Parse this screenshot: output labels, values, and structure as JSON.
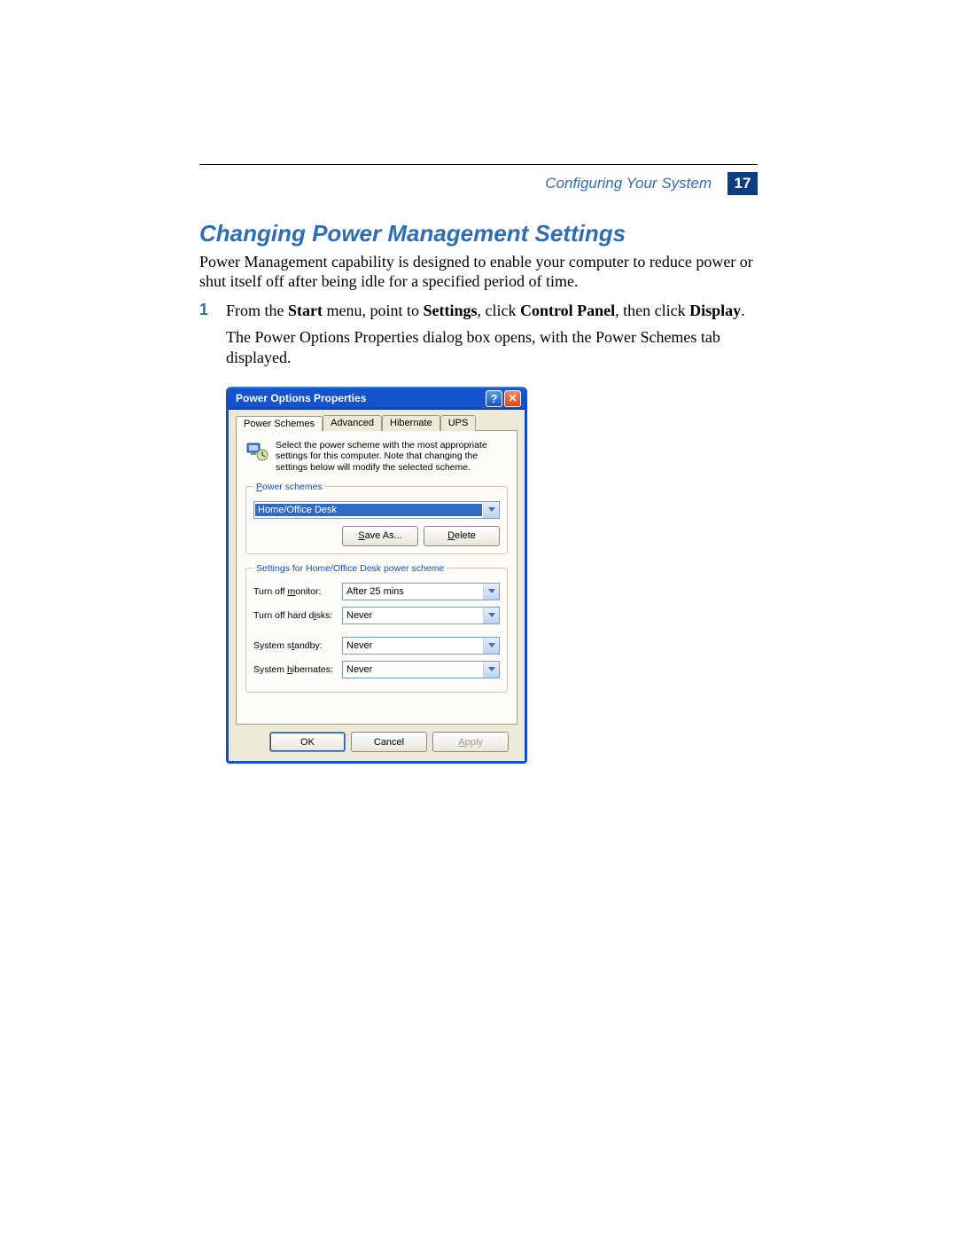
{
  "header": {
    "section": "Configuring Your System",
    "page_number": "17"
  },
  "heading": "Changing Power Management Settings",
  "intro": "Power Management capability is designed to enable your computer to reduce power or shut itself off after being idle for a specified period of time.",
  "step1": {
    "num": "1",
    "prefix": "From the ",
    "b1": "Start",
    "mid1": " menu, point to ",
    "b2": "Settings",
    "mid2": ", click ",
    "b3": "Control Panel",
    "mid3": ", then click ",
    "b4": "Display",
    "suffix": "."
  },
  "step1_follow": "The Power Options Properties dialog box opens, with the Power Schemes tab displayed.",
  "dialog": {
    "title": "Power Options Properties",
    "tabs": [
      "Power Schemes",
      "Advanced",
      "Hibernate",
      "UPS"
    ],
    "description": "Select the power scheme with the most appropriate settings for this computer. Note that changing the settings below will modify the selected scheme.",
    "group_schemes_legend": "Power schemes",
    "scheme_selected": "Home/Office Desk",
    "save_as": "Save As...",
    "delete": "Delete",
    "group_settings_legend": "Settings for Home/Office Desk power scheme",
    "settings": {
      "monitor_label_pre": "Turn off ",
      "monitor_label_ul": "m",
      "monitor_label_post": "onitor:",
      "monitor_value": "After 25 mins",
      "disks_label_pre": "Turn off hard d",
      "disks_label_ul": "i",
      "disks_label_post": "sks:",
      "disks_value": "Never",
      "standby_label_pre": "System s",
      "standby_label_ul": "t",
      "standby_label_post": "andby:",
      "standby_value": "Never",
      "hibernate_label_pre": "System ",
      "hibernate_label_ul": "h",
      "hibernate_label_post": "ibernates:",
      "hibernate_value": "Never"
    },
    "ok": "OK",
    "cancel": "Cancel",
    "apply": "Apply"
  }
}
